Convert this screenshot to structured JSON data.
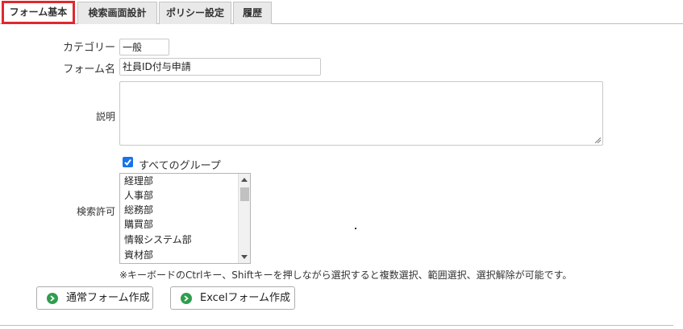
{
  "tabs": [
    {
      "label": "フォーム基本"
    },
    {
      "label": "検索画面設計"
    },
    {
      "label": "ポリシー設定"
    },
    {
      "label": "履歴"
    }
  ],
  "form": {
    "category_label": "カテゴリー",
    "category_value": "一般",
    "form_name_label": "フォーム名",
    "form_name_value": "社員ID付与申請",
    "description_label": "説明",
    "description_value": "",
    "search_permission_label": "検索許可",
    "all_groups_label": "すべてのグループ",
    "all_groups_checked": true,
    "groups": [
      "経理部",
      "人事部",
      "総務部",
      "購買部",
      "情報システム部",
      "資材部"
    ],
    "note": "※キーボードのCtrlキー、Shiftキーを押しながら選択すると複数選択、範囲選択、選択解除が可能です。"
  },
  "buttons": {
    "normal_form": "通常フォーム作成",
    "excel_form": "Excelフォーム作成"
  },
  "colors": {
    "active_tab_border": "#e0282e",
    "checkbox": "#1a73e8",
    "go_icon": "#2e9e4e"
  }
}
